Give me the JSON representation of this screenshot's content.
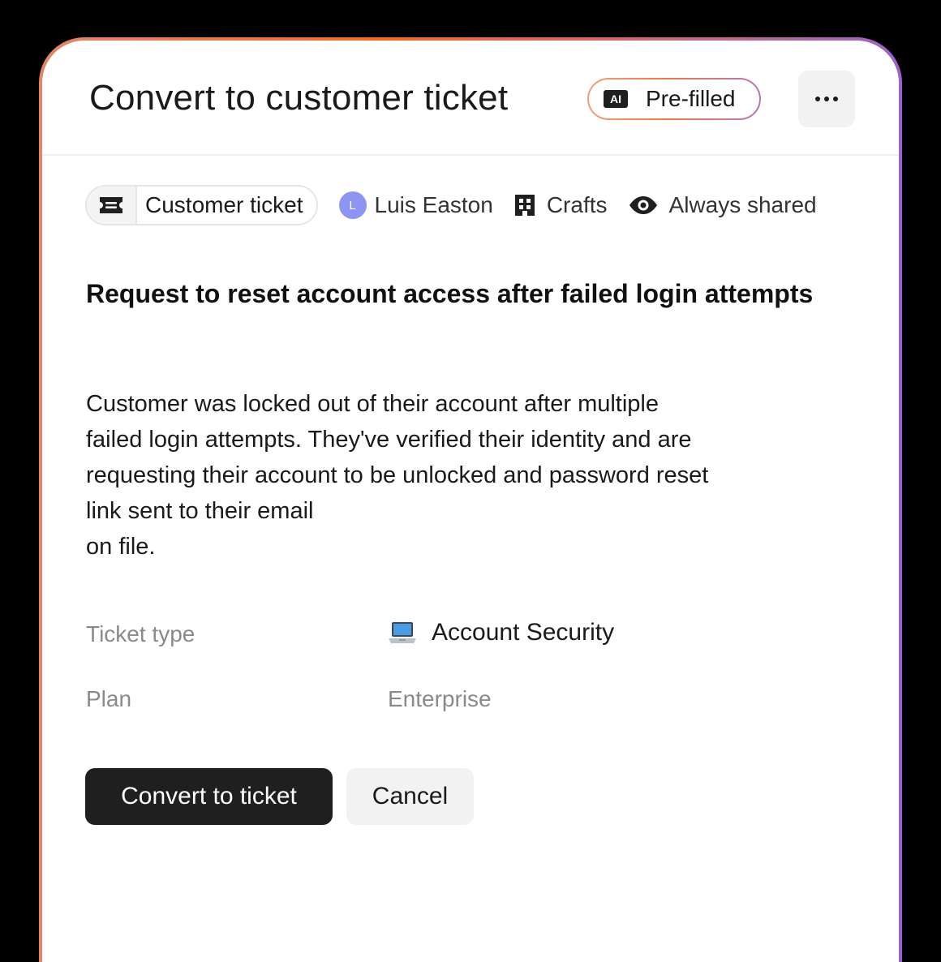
{
  "dialog": {
    "title": "Convert to customer ticket",
    "ai_badge": {
      "icon_text": "AI",
      "label": "Pre-filled"
    },
    "more_icon": "more-horizontal-icon"
  },
  "meta": {
    "type_chip": {
      "icon": "ticket-icon",
      "label": "Customer ticket"
    },
    "assignee": {
      "initial": "L",
      "name": "Luis Easton",
      "avatar_color": "#8e94f2"
    },
    "company": {
      "icon": "building-icon",
      "name": "Crafts"
    },
    "visibility": {
      "icon": "eye-icon",
      "label": "Always shared"
    }
  },
  "ticket": {
    "heading": "Request to reset account access after failed login attempts",
    "description": "Customer was locked out of their account after multiple\nfailed login attempts. They've verified their identity and are\nrequesting their account to be unlocked and password reset\nlink sent to their email\non file."
  },
  "fields": [
    {
      "label": "Ticket type",
      "value": "Account Security",
      "icon": "laptop-icon"
    },
    {
      "label": "Plan",
      "value": "Enterprise"
    }
  ],
  "actions": {
    "primary_label": "Convert to ticket",
    "secondary_label": "Cancel"
  },
  "colors": {
    "background": "#000000",
    "card": "#ffffff",
    "primary_button": "#1f1f1f",
    "secondary_button": "#f2f2f2",
    "border_gradient": [
      "#e0876a",
      "#f06b2c",
      "#c86a7e",
      "#9a64c6"
    ],
    "muted_text": "#8a8a8a"
  }
}
